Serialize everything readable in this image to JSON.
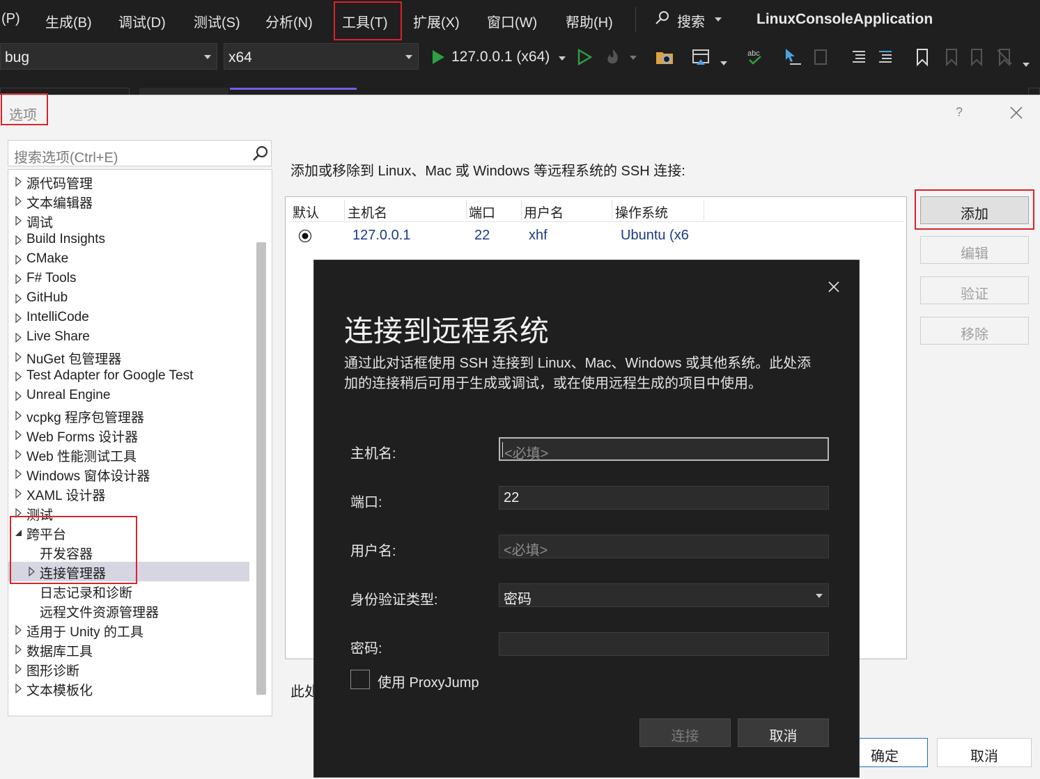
{
  "app": {
    "project_name": "LinuxConsoleApplication"
  },
  "menu": {
    "items": [
      {
        "label": "(P)"
      },
      {
        "label": "生成(B)"
      },
      {
        "label": "调试(D)"
      },
      {
        "label": "测试(S)"
      },
      {
        "label": "分析(N)"
      },
      {
        "label": "工具(T)"
      },
      {
        "label": "扩展(X)"
      },
      {
        "label": "窗口(W)"
      },
      {
        "label": "帮助(H)"
      }
    ],
    "search_label": "搜索"
  },
  "toolbar": {
    "config_value": "bug",
    "platform_value": "x64",
    "run_target": "127.0.0.1 (x64)"
  },
  "options_dialog": {
    "title": "选项",
    "help": "?",
    "search_placeholder": "搜索选项(Ctrl+E)",
    "tree": [
      {
        "label": "源代码管理",
        "indent": 0,
        "state": "collapsed"
      },
      {
        "label": "文本编辑器",
        "indent": 0,
        "state": "collapsed"
      },
      {
        "label": "调试",
        "indent": 0,
        "state": "collapsed"
      },
      {
        "label": "Build Insights",
        "indent": 0,
        "state": "collapsed"
      },
      {
        "label": "CMake",
        "indent": 0,
        "state": "collapsed"
      },
      {
        "label": "F# Tools",
        "indent": 0,
        "state": "collapsed"
      },
      {
        "label": "GitHub",
        "indent": 0,
        "state": "collapsed"
      },
      {
        "label": "IntelliCode",
        "indent": 0,
        "state": "collapsed"
      },
      {
        "label": "Live Share",
        "indent": 0,
        "state": "collapsed"
      },
      {
        "label": "NuGet 包管理器",
        "indent": 0,
        "state": "collapsed"
      },
      {
        "label": "Test Adapter for Google Test",
        "indent": 0,
        "state": "collapsed"
      },
      {
        "label": "Unreal Engine",
        "indent": 0,
        "state": "collapsed"
      },
      {
        "label": "vcpkg 程序包管理器",
        "indent": 0,
        "state": "collapsed"
      },
      {
        "label": "Web Forms 设计器",
        "indent": 0,
        "state": "collapsed"
      },
      {
        "label": "Web 性能测试工具",
        "indent": 0,
        "state": "collapsed"
      },
      {
        "label": "Windows 窗体设计器",
        "indent": 0,
        "state": "collapsed"
      },
      {
        "label": "XAML 设计器",
        "indent": 0,
        "state": "collapsed"
      },
      {
        "label": "测试",
        "indent": 0,
        "state": "collapsed"
      },
      {
        "label": "跨平台",
        "indent": 0,
        "state": "expanded"
      },
      {
        "label": "开发容器",
        "indent": 1,
        "state": "leaf"
      },
      {
        "label": "连接管理器",
        "indent": 1,
        "state": "collapsed",
        "selected": true
      },
      {
        "label": "日志记录和诊断",
        "indent": 1,
        "state": "leaf"
      },
      {
        "label": "远程文件资源管理器",
        "indent": 1,
        "state": "leaf"
      },
      {
        "label": "适用于 Unity 的工具",
        "indent": 0,
        "state": "collapsed"
      },
      {
        "label": "数据库工具",
        "indent": 0,
        "state": "collapsed"
      },
      {
        "label": "图形诊断",
        "indent": 0,
        "state": "collapsed"
      },
      {
        "label": "文本模板化",
        "indent": 0,
        "state": "collapsed"
      }
    ],
    "description": "添加或移除到 Linux、Mac 或 Windows 等远程系统的 SSH 连接:",
    "table": {
      "headers": [
        "默认",
        "主机名",
        "端口",
        "用户名",
        "操作系统"
      ],
      "rows": [
        {
          "default": true,
          "host": "127.0.0.1",
          "port": "22",
          "user": "xhf",
          "os": "Ubuntu (x6"
        }
      ]
    },
    "buttons": {
      "add": "添加",
      "edit": "编辑",
      "verify": "验证",
      "remove": "移除",
      "ok": "确定",
      "cancel": "取消"
    },
    "bottom_text": "此处"
  },
  "connect_dialog": {
    "title": "连接到远程系统",
    "description": "通过此对话框使用 SSH 连接到 Linux、Mac、Windows 或其他系统。此处添加的连接稍后可用于生成或调试，或在使用远程生成的项目中使用。",
    "fields": {
      "host_label": "主机名:",
      "host_placeholder": "<必填>",
      "port_label": "端口:",
      "port_value": "22",
      "user_label": "用户名:",
      "user_placeholder": "<必填>",
      "auth_label": "身份验证类型:",
      "auth_value": "密码",
      "password_label": "密码:"
    },
    "proxyjump_label": "使用 ProxyJump",
    "proxyjump_checked": false,
    "connect_button": "连接",
    "cancel_button": "取消"
  },
  "colors": {
    "highlight_red": "#d9232b",
    "link_blue": "#1b3a8a",
    "run_green": "#2ea043",
    "tab_accent": "#7160e8"
  }
}
